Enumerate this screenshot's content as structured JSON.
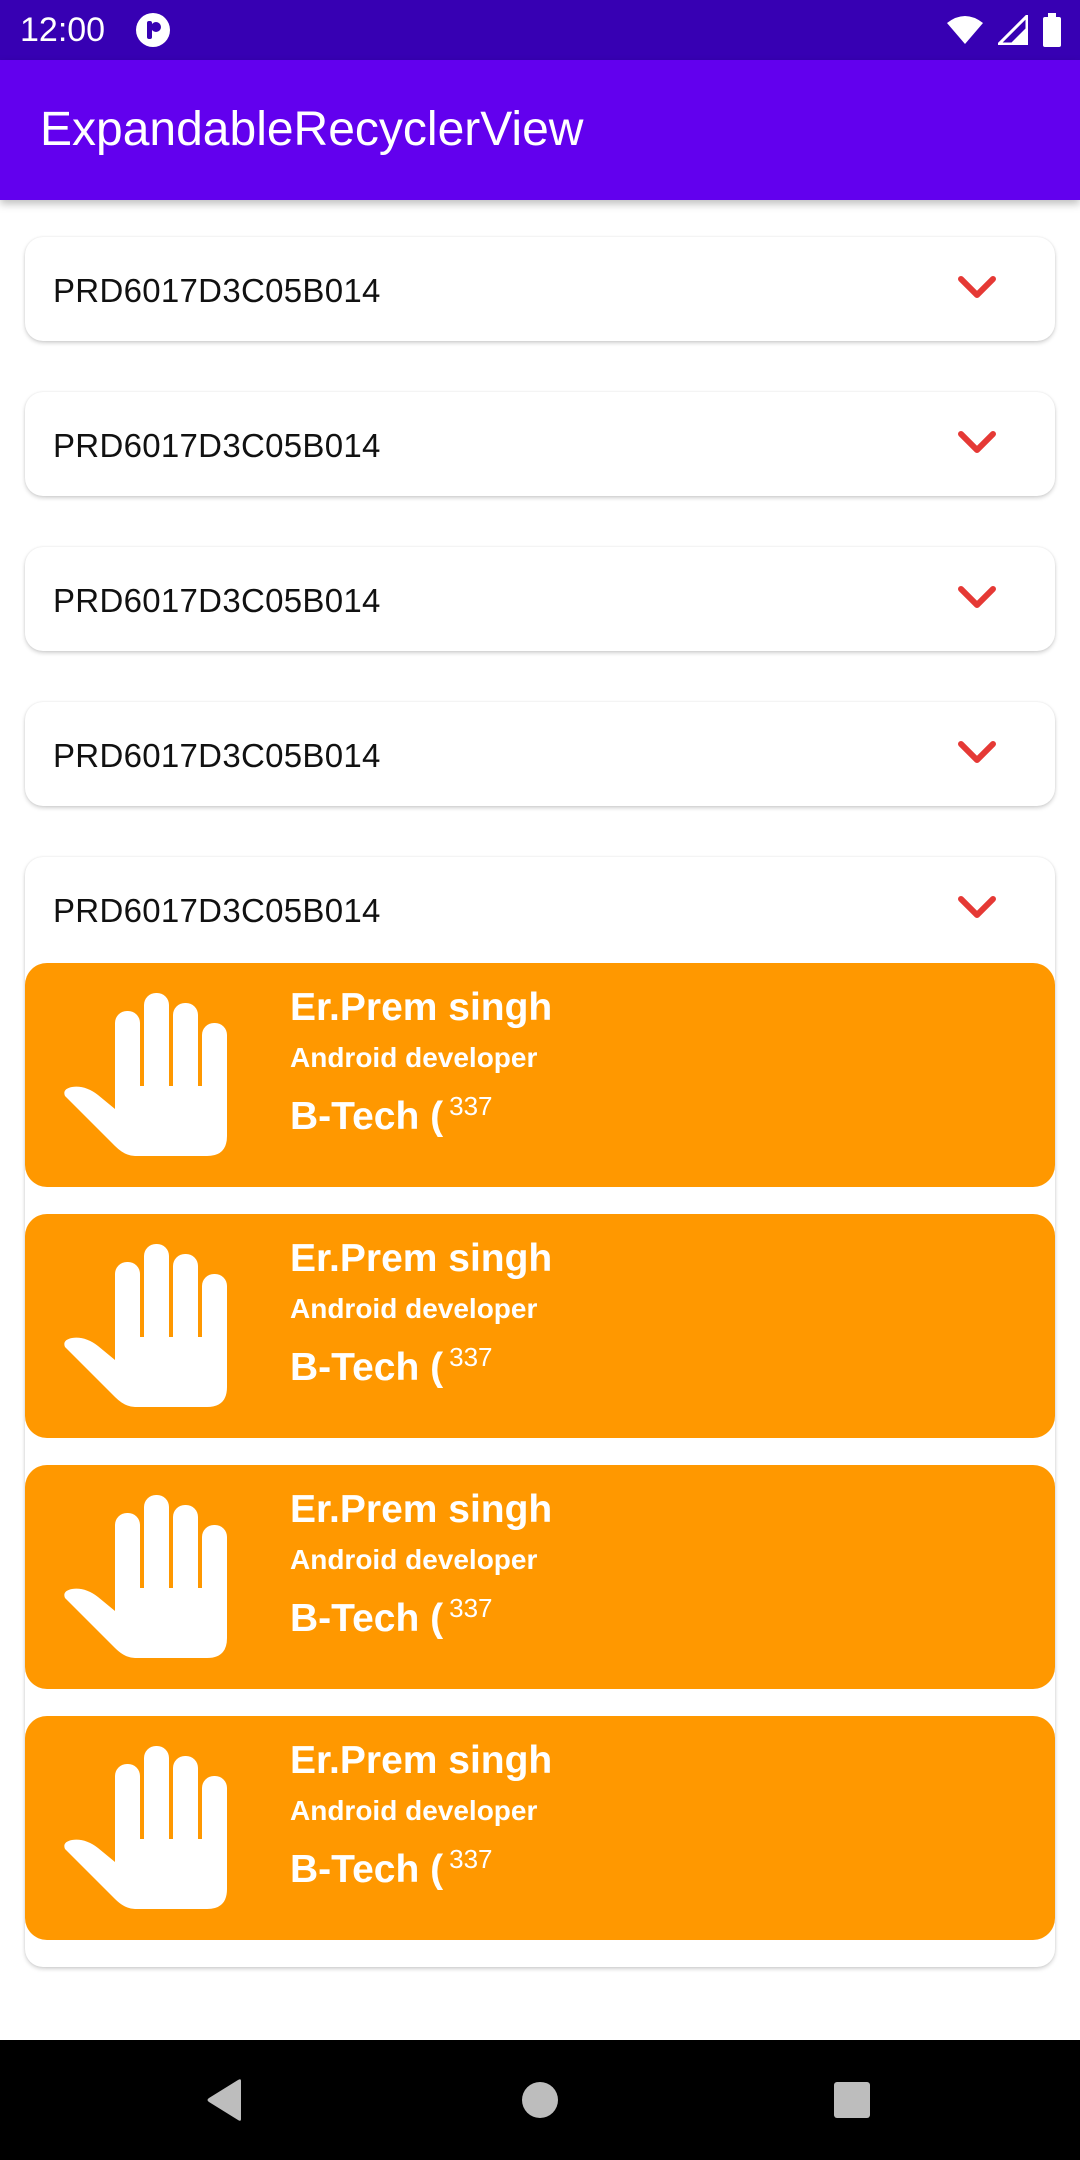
{
  "status_bar": {
    "time": "12:00"
  },
  "app_bar": {
    "title": "ExpandableRecyclerView"
  },
  "list_rows": [
    {
      "label": "PRD6017D3C05B014"
    },
    {
      "label": "PRD6017D3C05B014"
    },
    {
      "label": "PRD6017D3C05B014"
    },
    {
      "label": "PRD6017D3C05B014"
    },
    {
      "label": "PRD6017D3C05B014"
    }
  ],
  "detail_cards": [
    {
      "name": "Er.Prem singh",
      "role": "Android developer",
      "degree": "B-Tech (",
      "number": "337"
    },
    {
      "name": "Er.Prem singh",
      "role": "Android developer",
      "degree": "B-Tech (",
      "number": "337"
    },
    {
      "name": "Er.Prem singh",
      "role": "Android developer",
      "degree": "B-Tech (",
      "number": "337"
    },
    {
      "name": "Er.Prem singh",
      "role": "Android developer",
      "degree": "B-Tech (",
      "number": "337"
    }
  ],
  "colors": {
    "status_bar": "#3700b3",
    "app_bar": "#6200ee",
    "card": "#ff9800",
    "chevron": "#e53935"
  },
  "icons": {
    "status": [
      "app-notification-icon",
      "wifi-icon",
      "signal-icon",
      "battery-icon"
    ],
    "row": "chevron-down-icon",
    "card": "hand-icon",
    "nav": [
      "back-icon",
      "home-icon",
      "recents-icon"
    ]
  }
}
